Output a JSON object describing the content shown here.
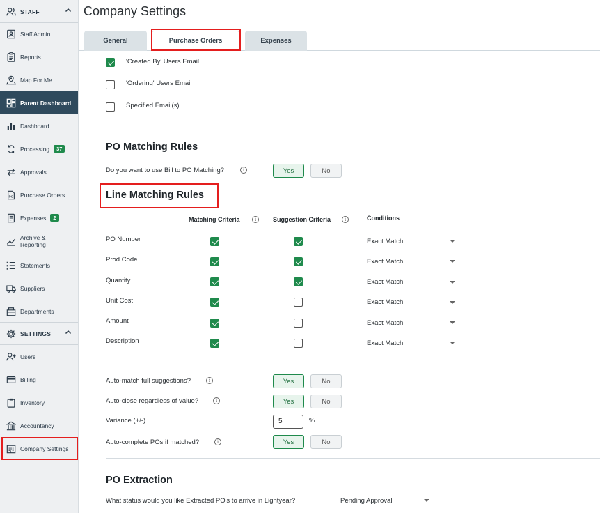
{
  "sidebar": {
    "staff_section": "STAFF",
    "items": [
      {
        "label": "Staff Admin"
      },
      {
        "label": "Reports"
      },
      {
        "label": "Map For Me"
      },
      {
        "label": "Parent Dashboard"
      },
      {
        "label": "Dashboard"
      },
      {
        "label": "Processing",
        "badge": "37"
      },
      {
        "label": "Approvals"
      },
      {
        "label": "Purchase Orders"
      },
      {
        "label": "Expenses",
        "badge": "2"
      },
      {
        "label": "Archive &"
      },
      {
        "label": "Statements"
      },
      {
        "label": "Suppliers"
      },
      {
        "label": "Departments"
      }
    ],
    "archive_line2": "Reporting",
    "settings_section": "SETTINGS",
    "settings_items": [
      {
        "label": "Users"
      },
      {
        "label": "Billing"
      },
      {
        "label": "Inventory"
      },
      {
        "label": "Accountancy"
      },
      {
        "label": "Company Settings"
      }
    ]
  },
  "page": {
    "title": "Company Settings",
    "tabs": [
      {
        "label": "General"
      },
      {
        "label": "Purchase Orders",
        "active": true
      },
      {
        "label": "Expenses"
      }
    ]
  },
  "email_options": [
    {
      "label": "'Created By' Users Email",
      "checked": true
    },
    {
      "label": "'Ordering' Users Email",
      "checked": false
    },
    {
      "label": "Specified Email(s)",
      "checked": false
    }
  ],
  "po_matching": {
    "heading": "PO Matching Rules",
    "question": "Do you want to use Bill to PO Matching?",
    "yes": "Yes",
    "no": "No",
    "selected": "Yes"
  },
  "line_matching": {
    "heading": "Line Matching Rules",
    "col_matching": "Matching Criteria",
    "col_suggestion": "Suggestion Criteria",
    "col_conditions": "Conditions",
    "rows": [
      {
        "label": "PO Number",
        "matching": true,
        "suggestion": true,
        "condition": "Exact Match"
      },
      {
        "label": "Prod Code",
        "matching": true,
        "suggestion": true,
        "condition": "Exact Match"
      },
      {
        "label": "Quantity",
        "matching": true,
        "suggestion": true,
        "condition": "Exact Match"
      },
      {
        "label": "Unit Cost",
        "matching": true,
        "suggestion": false,
        "condition": "Exact Match"
      },
      {
        "label": "Amount",
        "matching": true,
        "suggestion": false,
        "condition": "Exact Match"
      },
      {
        "label": "Description",
        "matching": true,
        "suggestion": false,
        "condition": "Exact Match"
      }
    ]
  },
  "auto_settings": {
    "auto_match_label": "Auto-match full suggestions?",
    "auto_close_label": "Auto-close regardless of value?",
    "variance_label": "Variance (+/-)",
    "variance_value": "5",
    "variance_unit": "%",
    "auto_complete_label": "Auto-complete POs if matched?",
    "yes": "Yes",
    "no": "No"
  },
  "po_extraction": {
    "heading": "PO Extraction",
    "question": "What status would you like Extracted PO's to arrive in Lightyear?",
    "value": "Pending Approval"
  },
  "colors": {
    "accent_green": "#1f8a4c",
    "sidebar_active": "#2f4a5d",
    "highlight_red": "#e41e1e"
  }
}
